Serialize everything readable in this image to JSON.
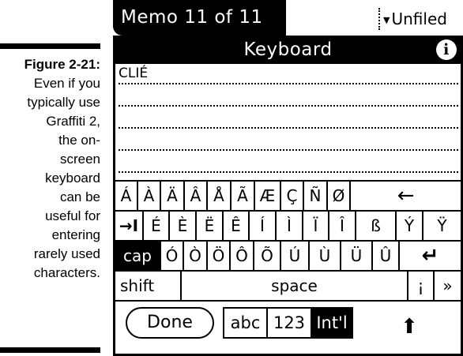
{
  "caption": {
    "figure": "Figure 2-21:",
    "text_lines": [
      "Even if you",
      "typically use",
      "Graffiti 2,",
      "the on-",
      "screen",
      "keyboard",
      "can be",
      "useful for",
      "entering",
      "rarely used",
      "characters."
    ]
  },
  "titlebar": {
    "memo_title": "Memo 11 of 11",
    "category": "Unfiled",
    "category_arrow": "▼"
  },
  "keyboard_header": {
    "title": "Keyboard",
    "info_glyph": "i"
  },
  "text_area": {
    "lines": [
      "CLIÉ",
      "",
      "",
      "",
      ""
    ]
  },
  "keyboard": {
    "row1": [
      "Á",
      "À",
      "Ä",
      "Â",
      "Å",
      "Ã",
      "Æ",
      "Ç",
      "Ñ",
      "Ø",
      "←"
    ],
    "row2": [
      "→I",
      "É",
      "È",
      "Ë",
      "Ê",
      "Í",
      "Ì",
      "Ï",
      "Î",
      "ß",
      "Ý",
      "Ÿ"
    ],
    "row3": [
      "cap",
      "Ó",
      "Ò",
      "Ö",
      "Ô",
      "Õ",
      "Ú",
      "Ù",
      "Ü",
      "Û",
      "↵"
    ],
    "row4": [
      "shift",
      "space",
      "¡",
      "»"
    ]
  },
  "controls": {
    "done_label": "Done",
    "modes": [
      "abc",
      "123",
      "Int'l"
    ],
    "active_mode": "Int'l",
    "shift_arrow": "⬆"
  }
}
